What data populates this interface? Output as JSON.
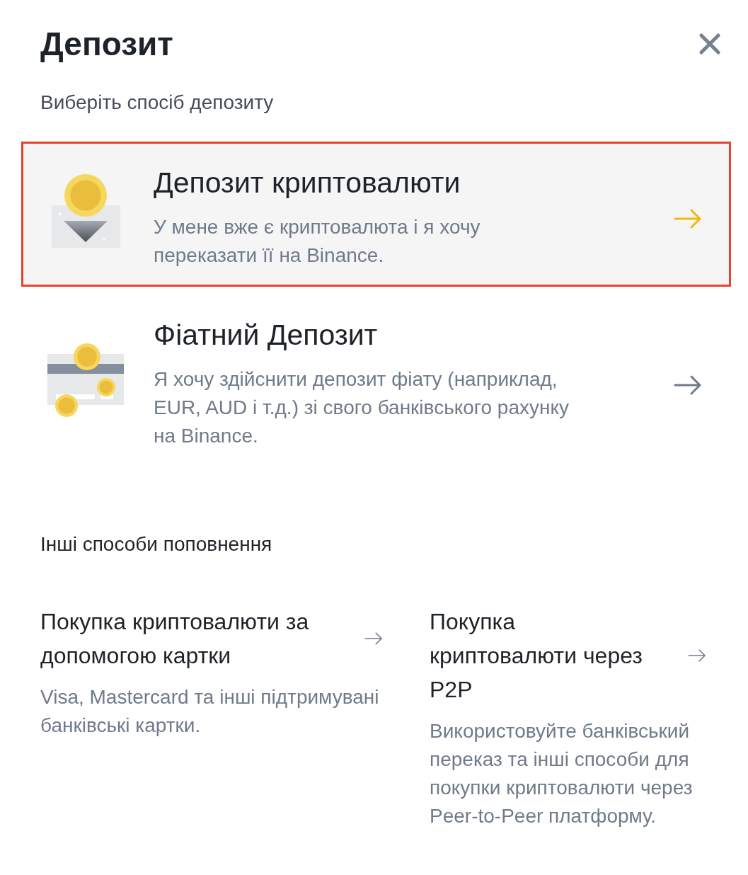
{
  "header": {
    "title": "Депозит",
    "prompt": "Виберіть спосіб депозиту"
  },
  "methods": [
    {
      "kind": "crypto",
      "title": "Депозит криптовалюти",
      "description": "У мене вже є криптовалюта і я хочу переказати її на Binance.",
      "selected": true,
      "highlighted": true
    },
    {
      "kind": "fiat",
      "title": "Фіатний Депозит",
      "description": "Я хочу здійснити депозит фіату (наприклад, EUR, AUD і т.д.) зі свого банківського рахунку на Binance.",
      "selected": false,
      "highlighted": false
    }
  ],
  "other": {
    "heading": "Інші способи поповнення",
    "options": [
      {
        "title": "Покупка криптовалюти за допомогою картки",
        "description": "Visa, Mastercard та інші підтримувані банківські картки."
      },
      {
        "title": "Покупка криптовалюти через P2P",
        "description": "Використовуйте банківський переказ та інші способи для покупки криптовалюти через Peer-to-Peer платформу."
      }
    ]
  }
}
